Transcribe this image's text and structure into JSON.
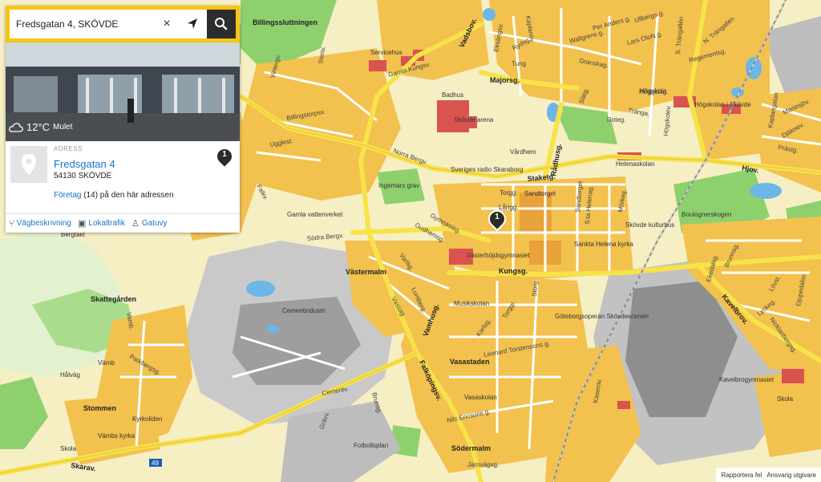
{
  "search": {
    "value": "Fredsgatan 4, SKÖVDE",
    "clear_symbol": "×"
  },
  "weather": {
    "temperature": "12°C",
    "description": "Mulet"
  },
  "address": {
    "heading": "ADRESS",
    "street": "Fredsgatan 4",
    "postal": "54130 SKÖVDE",
    "companies_link": "Företag",
    "companies_rest": " (14) på den här adressen"
  },
  "actions": [
    {
      "label": "Vägbeskrivning",
      "icon": "directions-icon"
    },
    {
      "label": "Lokaltrafik",
      "icon": "bus-icon"
    },
    {
      "label": "Gatuvy",
      "icon": "person-icon"
    }
  ],
  "markers": [
    {
      "number": "1"
    },
    {
      "number": "1"
    }
  ],
  "footer": {
    "report": "Rapportera fel",
    "terms": "Ansvarig utgivare"
  },
  "colors": {
    "background": "#f6efc4",
    "block": "#f2c14e",
    "road": "#ffffff",
    "main_road": "#f7e24a",
    "park": "#7ccf6a",
    "water": "#6cb6e8",
    "industry": "#b6b6b6",
    "building": "#d9534f",
    "brand": "#f5c518"
  },
  "map": {
    "areas": [
      "Billingssluttningen",
      "Skattegården",
      "Västermalm",
      "Vasastaden",
      "Södermalm",
      "Stommen",
      "Hålväg",
      "Vämb",
      "Skola",
      "Cementindustri",
      "Gamla vattenverket",
      "Ingemars grav",
      "Skövde arena",
      "Badhus",
      "Sankta Helena kyrka",
      "Vämbs kyrka",
      "Kyrkoliden",
      "Fotbollsplan",
      "Göteborgsoperan Skövdescenen",
      "Kavelbrogymnasiet",
      "Helenaskolan",
      "Musikskolan",
      "Vasaskolan",
      "Västerhöjdsgymnasiet",
      "Sveriges radio Skaraborg",
      "Högskolan i Skövde",
      "Bergtäkt",
      "Servicehus",
      "Torgg.",
      "Sandtorget",
      "Långg.",
      "Skövde kulturhus",
      "Boulognerskogen",
      "Högskola",
      "Vårdhem",
      "Skola"
    ],
    "streets": [
      "Norra Bergv.",
      "Södra Bergv.",
      "Kungsg.",
      "Skarav.",
      "Hjov.",
      "Kavelbrov.",
      "Majorsg.",
      "Vadsbov.",
      "Staketg.",
      "Rådhusg.",
      "Gymnasieg.",
      "Gudhemsg.",
      "Varfsg.",
      "Lumberg.",
      "Vassag",
      "Vamb.",
      "Falköpingsv.",
      "Vamhusg.",
      "Cementv.",
      "Nils Ericsons g.",
      "Leonard Torstensons g.",
      "Torggr.",
      "Storg.",
      "Karlsg.",
      "Eksängsv.",
      "Gamla Kungsv.",
      "N. Trängallén",
      "S. Trängallén",
      "Regementsg.",
      "Billingstorpsv.",
      "Ugglest.",
      "Falkv.",
      "Vintergv.",
      "Stenv.",
      "Ullbergs g.",
      "Per Anders g.",
      "Wallgrens g.",
      "Lars Olofs g.",
      "Granskag.",
      "Tung",
      "Rydsg.",
      "Kaplansv.",
      "Höggstag.",
      "Tränga.",
      "Roteg.",
      "Slätg.",
      "Högskolev.",
      "Kaplangatan",
      "Mariesjöv.",
      "Djäknev.",
      "Prästg.",
      "Ekedalsg.",
      "Brunnsg.",
      "Lövst.",
      "Lyckeg.",
      "Nicklasbergsg.",
      "Djupedalsv.",
      "Järnvägsg.",
      "Brunsg.",
      "Grävv.",
      "Kasernv.",
      "Parkbergsg.",
      "S:ta Helenag.",
      "Mörkeg.",
      "Sandtorget"
    ],
    "route_shield": "49"
  }
}
